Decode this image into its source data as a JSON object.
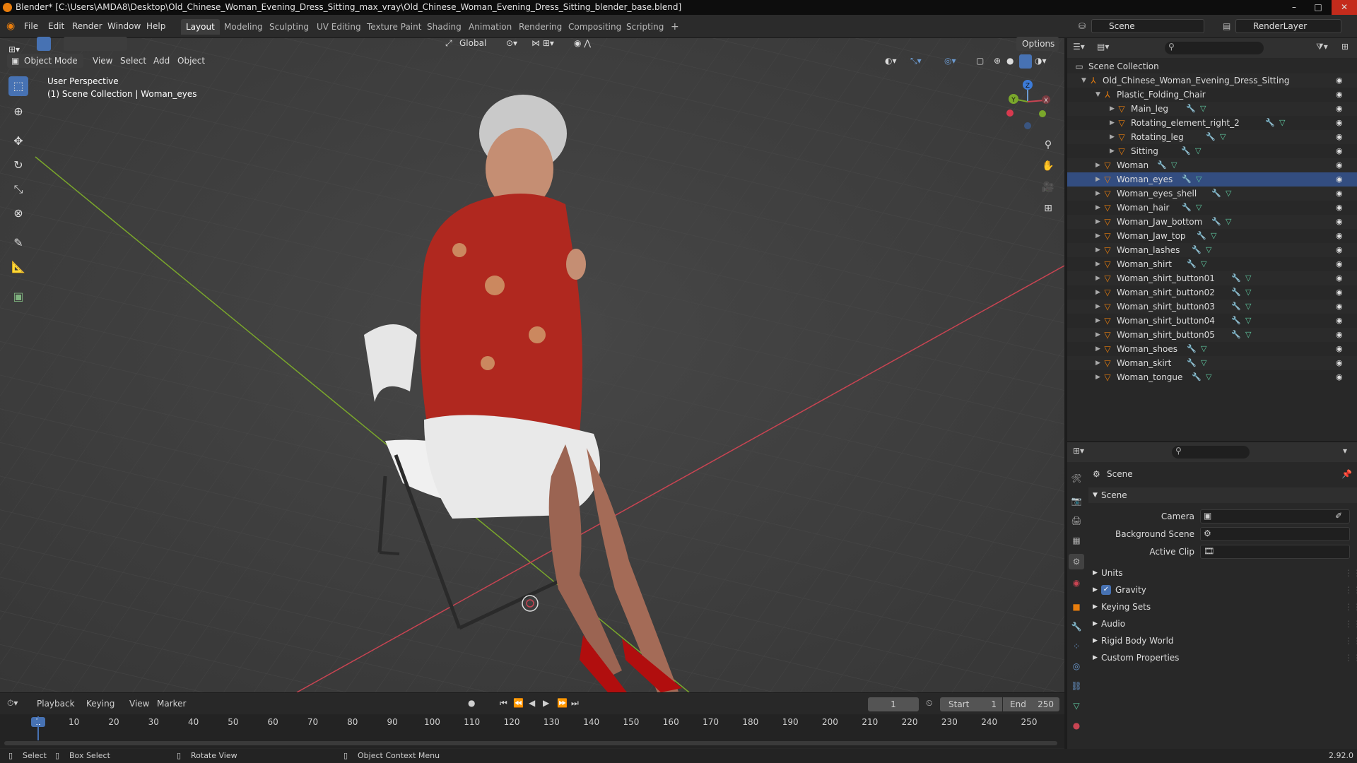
{
  "window": {
    "title": "Blender* [C:\\Users\\AMDA8\\Desktop\\Old_Chinese_Woman_Evening_Dress_Sitting_max_vray\\Old_Chinese_Woman_Evening_Dress_Sitting_blender_base.blend]",
    "minimize": "–",
    "maximize": "□",
    "close": "✕"
  },
  "menu": {
    "file": "File",
    "edit": "Edit",
    "render": "Render",
    "window": "Window",
    "help": "Help"
  },
  "workspaces": [
    "Layout",
    "Modeling",
    "Sculpting",
    "UV Editing",
    "Texture Paint",
    "Shading",
    "Animation",
    "Rendering",
    "Compositing",
    "Scripting"
  ],
  "add_workspace": "+",
  "scene_field": "Scene",
  "renderlayer_field": "RenderLayer",
  "viewport": {
    "transform_orientation": "Global",
    "options": "Options",
    "mode": "Object Mode",
    "menus": [
      "View",
      "Select",
      "Add",
      "Object"
    ],
    "perspective": "User Perspective",
    "collection_info": "(1) Scene Collection | Woman_eyes",
    "gizmo": {
      "x": "X",
      "y": "Y",
      "z": "Z"
    }
  },
  "outliner": {
    "root": "Scene Collection",
    "items": [
      {
        "name": "Old_Chinese_Woman_Evening_Dress_Sitting",
        "depth": 1,
        "type": "empty"
      },
      {
        "name": "Plastic_Folding_Chair",
        "depth": 2,
        "type": "empty"
      },
      {
        "name": "Main_leg",
        "depth": 3,
        "type": "mesh"
      },
      {
        "name": "Rotating_element_right_2",
        "depth": 3,
        "type": "mesh"
      },
      {
        "name": "Rotating_leg",
        "depth": 3,
        "type": "mesh"
      },
      {
        "name": "Sitting",
        "depth": 3,
        "type": "mesh"
      },
      {
        "name": "Woman",
        "depth": 2,
        "type": "mesh"
      },
      {
        "name": "Woman_eyes",
        "depth": 2,
        "type": "mesh"
      },
      {
        "name": "Woman_eyes_shell",
        "depth": 2,
        "type": "mesh"
      },
      {
        "name": "Woman_hair",
        "depth": 2,
        "type": "mesh"
      },
      {
        "name": "Woman_Jaw_bottom",
        "depth": 2,
        "type": "mesh"
      },
      {
        "name": "Woman_Jaw_top",
        "depth": 2,
        "type": "mesh"
      },
      {
        "name": "Woman_lashes",
        "depth": 2,
        "type": "mesh"
      },
      {
        "name": "Woman_shirt",
        "depth": 2,
        "type": "mesh"
      },
      {
        "name": "Woman_shirt_button01",
        "depth": 2,
        "type": "mesh"
      },
      {
        "name": "Woman_shirt_button02",
        "depth": 2,
        "type": "mesh"
      },
      {
        "name": "Woman_shirt_button03",
        "depth": 2,
        "type": "mesh"
      },
      {
        "name": "Woman_shirt_button04",
        "depth": 2,
        "type": "mesh"
      },
      {
        "name": "Woman_shirt_button05",
        "depth": 2,
        "type": "mesh"
      },
      {
        "name": "Woman_shoes",
        "depth": 2,
        "type": "mesh"
      },
      {
        "name": "Woman_skirt",
        "depth": 2,
        "type": "mesh"
      },
      {
        "name": "Woman_tongue",
        "depth": 2,
        "type": "mesh"
      }
    ]
  },
  "properties": {
    "breadcrumb": "Scene",
    "panel": "Scene",
    "camera_label": "Camera",
    "background_scene_label": "Background Scene",
    "active_clip_label": "Active Clip",
    "sections": [
      "Units",
      "Gravity",
      "Keying Sets",
      "Audio",
      "Rigid Body World",
      "Custom Properties"
    ],
    "gravity_checked": true
  },
  "timeline": {
    "menus": [
      "Playback",
      "Keying",
      "View",
      "Marker"
    ],
    "current_frame": "1",
    "start_label": "Start",
    "start_value": "1",
    "end_label": "End",
    "end_value": "250",
    "ticks": [
      "1",
      "10",
      "20",
      "30",
      "40",
      "50",
      "60",
      "70",
      "80",
      "90",
      "100",
      "110",
      "120",
      "130",
      "140",
      "150",
      "160",
      "170",
      "180",
      "190",
      "200",
      "210",
      "220",
      "230",
      "240",
      "250"
    ]
  },
  "status": {
    "select": "Select",
    "box_select": "Box Select",
    "rotate_view": "Rotate View",
    "context_menu": "Object Context Menu",
    "version": "2.92.0"
  },
  "colors": {
    "accent": "#4772b3",
    "object_orange": "#e87d0d",
    "mesh_green": "#5fc9a0",
    "axis_red": "#c94452",
    "axis_green": "#7aa72b"
  }
}
